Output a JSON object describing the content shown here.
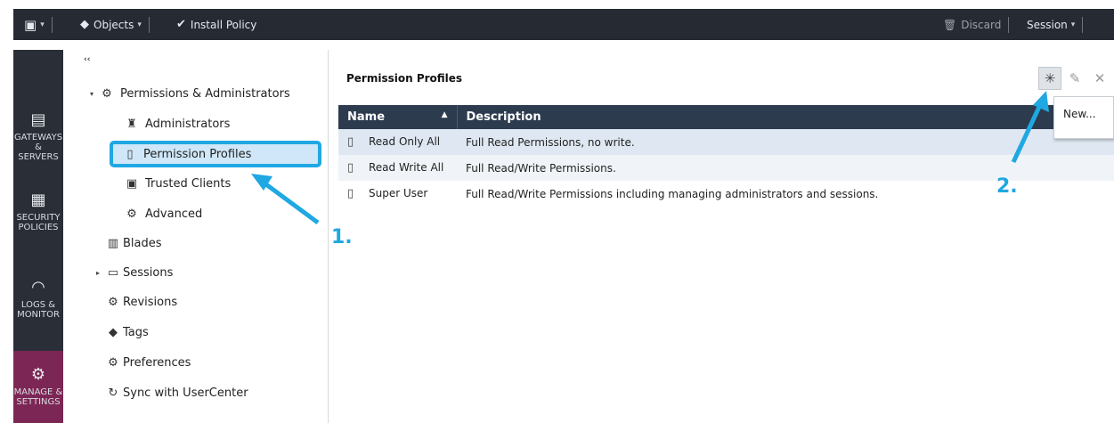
{
  "toolbar": {
    "app_menu_caret": "▾",
    "objects_label": "Objects",
    "install_policy_label": "Install Policy",
    "discard_label": "Discard",
    "session_label": "Session"
  },
  "leftnav": {
    "items": [
      {
        "label": "GATEWAYS & SERVERS",
        "icon": "gateways-icon"
      },
      {
        "label": "SECURITY POLICIES",
        "icon": "policies-icon"
      },
      {
        "label": "LOGS & MONITOR",
        "icon": "logs-icon"
      },
      {
        "label": "MANAGE & SETTINGS",
        "icon": "gear-icon",
        "active": true
      }
    ]
  },
  "tree": {
    "collapse_glyph": "‹‹",
    "nodes": [
      {
        "label": "Permissions & Administrators",
        "icon": "gear-icon",
        "expanded": true
      },
      {
        "label": "Administrators",
        "icon": "administrators-icon"
      },
      {
        "label": "Permission Profiles",
        "icon": "profile-icon",
        "selected": true
      },
      {
        "label": "Trusted Clients",
        "icon": "trusted-clients-icon"
      },
      {
        "label": "Advanced",
        "icon": "gear-icon"
      },
      {
        "label": "Blades",
        "icon": "blades-icon"
      },
      {
        "label": "Sessions",
        "icon": "sessions-icon",
        "expandable": true
      },
      {
        "label": "Revisions",
        "icon": "gear-icon"
      },
      {
        "label": "Tags",
        "icon": "tag-icon"
      },
      {
        "label": "Preferences",
        "icon": "gear-icon"
      },
      {
        "label": "Sync with UserCenter",
        "icon": "sync-icon"
      }
    ]
  },
  "content": {
    "title": "Permission Profiles",
    "new_tooltip": "New...",
    "columns": {
      "name": "Name",
      "description": "Description"
    },
    "rows": [
      {
        "name": "Read Only All",
        "description": "Full Read Permissions, no write."
      },
      {
        "name": "Read Write All",
        "description": "Full Read/Write Permissions."
      },
      {
        "name": "Super User",
        "description": "Full Read/Write Permissions including managing administrators and sessions."
      }
    ]
  },
  "annotations": {
    "step1": "1.",
    "step2": "2.",
    "color": "#1fa8e2"
  }
}
